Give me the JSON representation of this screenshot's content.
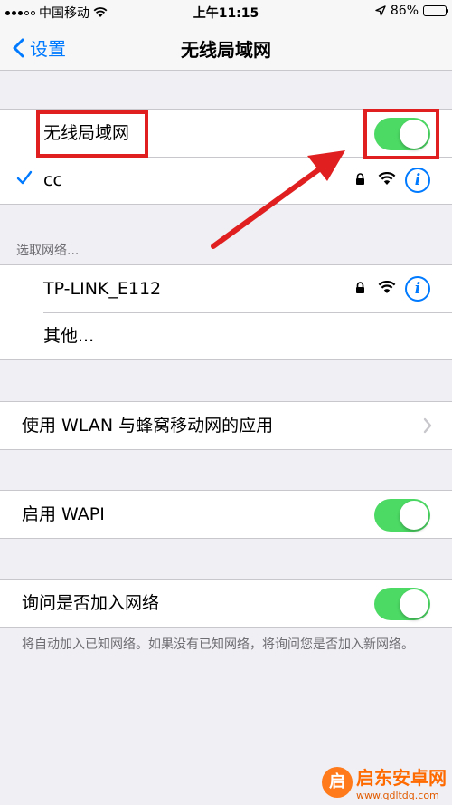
{
  "status_bar": {
    "carrier": "中国移动",
    "time": "上午11:15",
    "battery_percent": "86%",
    "battery_level": 0.86,
    "icons": [
      "signal-icon",
      "wifi-icon",
      "location-arrow-icon",
      "battery-icon"
    ]
  },
  "nav": {
    "back_label": "设置",
    "title": "无线局域网"
  },
  "wlan_section": {
    "toggle_label": "无线局域网",
    "toggle_on": true,
    "connected_network": "cc"
  },
  "choose_network": {
    "header": "选取网络...",
    "networks": [
      {
        "name": "TP-LINK_E112",
        "secured": true
      },
      {
        "name": "其他...",
        "secured": false
      }
    ]
  },
  "apps_row": {
    "label": "使用 WLAN 与蜂窝移动网的应用"
  },
  "wapi": {
    "label": "启用 WAPI",
    "on": true
  },
  "ask_join": {
    "label": "询问是否加入网络",
    "on": true,
    "footer": "将自动加入已知网络。如果没有已知网络，将询问您是否加入新网络。"
  },
  "watermark": {
    "logo_char": "启",
    "title": "启东安卓网",
    "url": "www.qdltdq.com"
  },
  "colors": {
    "accent": "#007aff",
    "toggle_on": "#4cd964",
    "annotation_red": "#e02020",
    "background": "#efeff4"
  }
}
